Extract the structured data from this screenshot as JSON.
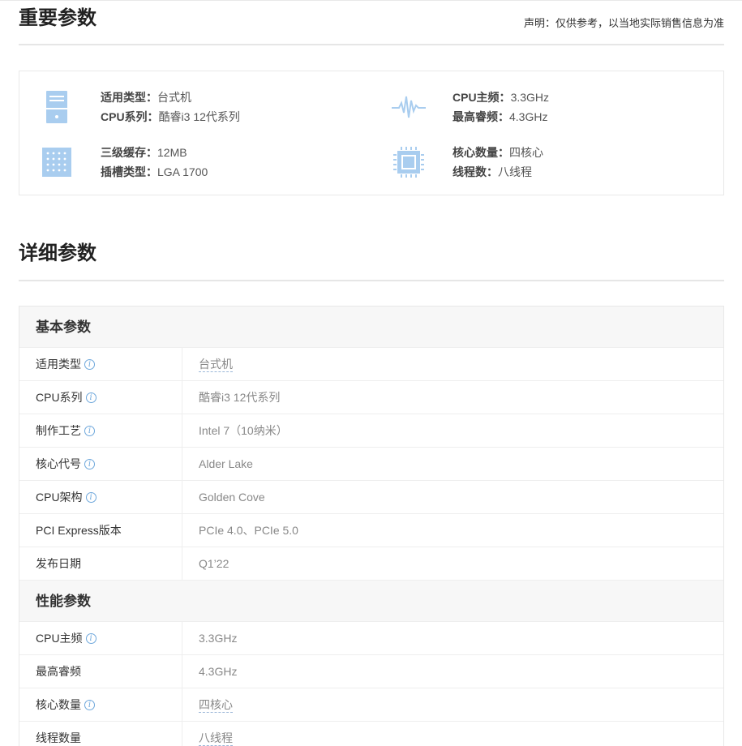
{
  "important": {
    "title": "重要参数",
    "disclaimer": "声明：仅供参考，以当地实际销售信息为准",
    "items": [
      {
        "icon": "desktop-tower-icon",
        "lines": [
          {
            "k": "适用类型：",
            "v": "台式机"
          },
          {
            "k": "CPU系列：",
            "v": "酷睿i3 12代系列"
          }
        ]
      },
      {
        "icon": "frequency-wave-icon",
        "lines": [
          {
            "k": "CPU主频：",
            "v": "3.3GHz"
          },
          {
            "k": "最高睿频：",
            "v": "4.3GHz"
          }
        ]
      },
      {
        "icon": "cache-grid-icon",
        "lines": [
          {
            "k": "三级缓存：",
            "v": "12MB"
          },
          {
            "k": "插槽类型：",
            "v": "LGA 1700"
          }
        ]
      },
      {
        "icon": "cpu-chip-icon",
        "lines": [
          {
            "k": "核心数量：",
            "v": "四核心"
          },
          {
            "k": "线程数：",
            "v": "八线程"
          }
        ]
      }
    ]
  },
  "detail": {
    "title": "详细参数",
    "groups": [
      {
        "title": "基本参数",
        "rows": [
          {
            "label": "适用类型",
            "info": true,
            "value": "台式机",
            "dashed": true
          },
          {
            "label": "CPU系列",
            "info": true,
            "value": "酷睿i3 12代系列",
            "dashed": false
          },
          {
            "label": "制作工艺",
            "info": true,
            "value": "Intel 7（10纳米）",
            "dashed": false
          },
          {
            "label": "核心代号",
            "info": true,
            "value": "Alder Lake",
            "dashed": false
          },
          {
            "label": "CPU架构",
            "info": true,
            "value": "Golden Cove",
            "dashed": false
          },
          {
            "label": "PCI Express版本",
            "info": false,
            "value": "PCIe 4.0、PCIe 5.0",
            "dashed": false
          },
          {
            "label": "发布日期",
            "info": false,
            "value": "Q1’22",
            "dashed": false
          }
        ]
      },
      {
        "title": "性能参数",
        "rows": [
          {
            "label": "CPU主频",
            "info": true,
            "value": "3.3GHz",
            "dashed": false
          },
          {
            "label": "最高睿频",
            "info": false,
            "value": "4.3GHz",
            "dashed": false
          },
          {
            "label": "核心数量",
            "info": true,
            "value": "四核心",
            "dashed": true
          },
          {
            "label": "线程数量",
            "info": false,
            "value": "八线程",
            "dashed": true
          }
        ]
      }
    ]
  },
  "colors": {
    "icon": "#a9cdef",
    "info": "#6fa8dc"
  }
}
